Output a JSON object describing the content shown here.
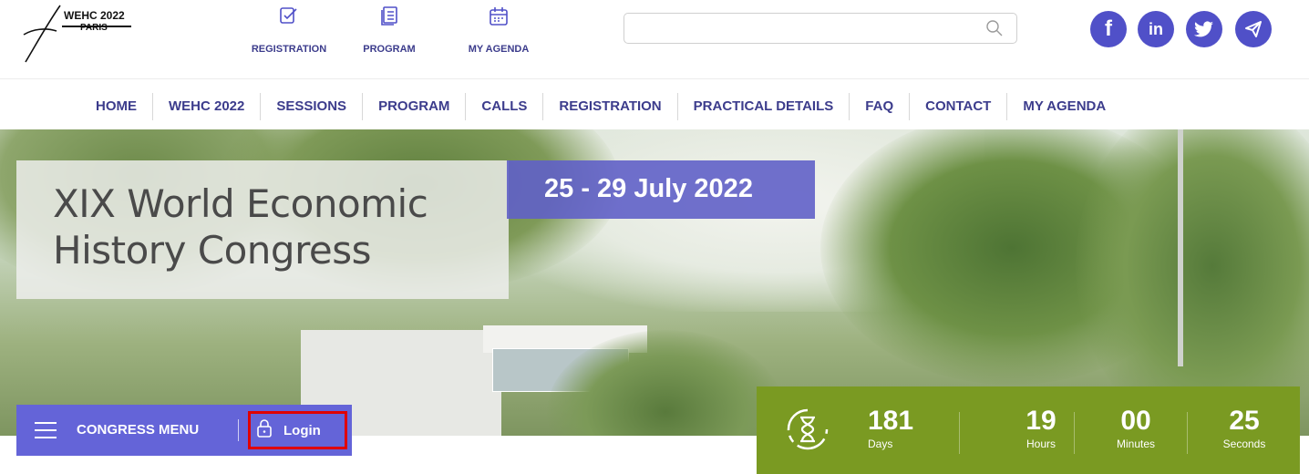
{
  "logo": {
    "title": "WEHC 2022",
    "subtitle": "PARIS"
  },
  "quick_links": {
    "registration": "REGISTRATION",
    "program": "PROGRAM",
    "my_agenda": "MY AGENDA"
  },
  "search": {
    "placeholder": "",
    "value": ""
  },
  "social": [
    "facebook-icon",
    "linkedin-icon",
    "twitter-icon",
    "telegram-icon"
  ],
  "nav": [
    {
      "label": "HOME"
    },
    {
      "label": "WEHC 2022"
    },
    {
      "label": "SESSIONS"
    },
    {
      "label": "PROGRAM"
    },
    {
      "label": "CALLS"
    },
    {
      "label": "REGISTRATION"
    },
    {
      "label": "PRACTICAL DETAILS"
    },
    {
      "label": "FAQ"
    },
    {
      "label": "CONTACT"
    },
    {
      "label": "MY AGENDA"
    }
  ],
  "hero": {
    "title_line1": "XIX World Economic",
    "title_line2": "History Congress",
    "dates": "25 - 29 July 2022"
  },
  "congress_bar": {
    "menu_label": "CONGRESS MENU",
    "login_label": "Login"
  },
  "countdown": {
    "days": {
      "value": "181",
      "label": "Days"
    },
    "hours": {
      "value": "19",
      "label": "Hours"
    },
    "minutes": {
      "value": "00",
      "label": "Minutes"
    },
    "seconds": {
      "value": "25",
      "label": "Seconds"
    }
  },
  "colors": {
    "primary": "#3c3c8c",
    "accent_purple": "#6464d8",
    "social": "#5050c8",
    "countdown_green": "#7a9a22",
    "highlight_red": "#e00000"
  }
}
